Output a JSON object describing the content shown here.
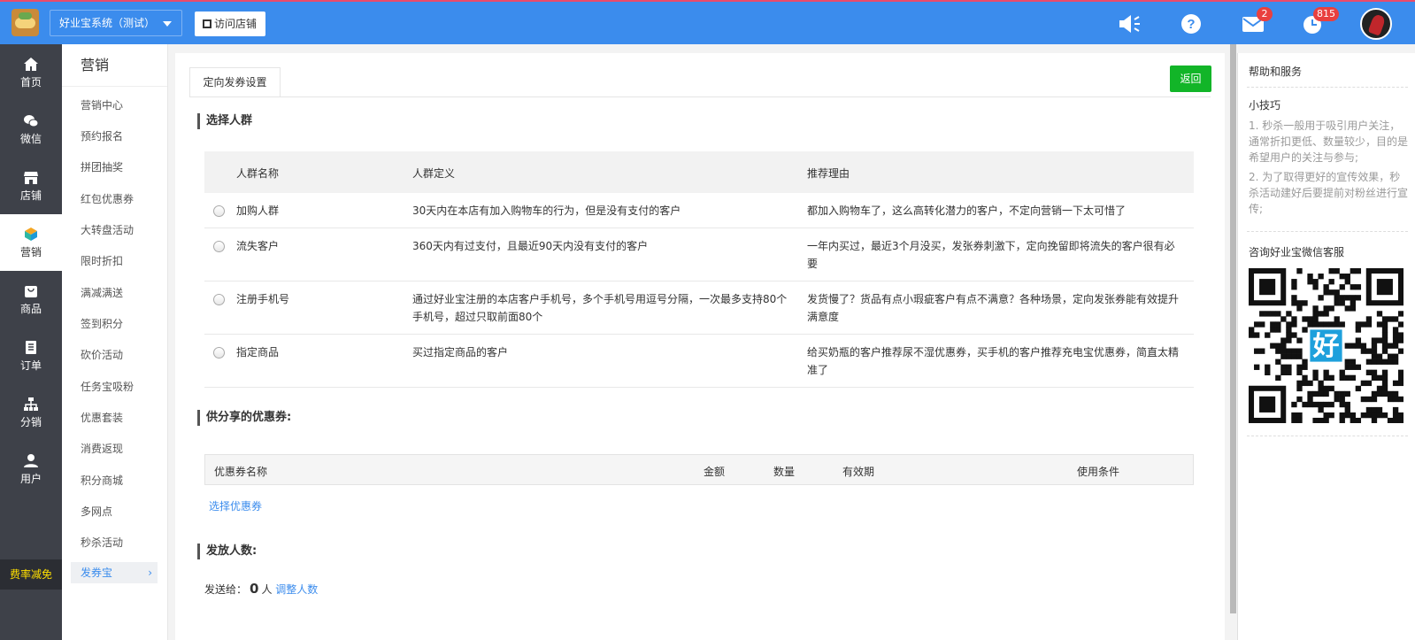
{
  "topbar": {
    "store_name": "好业宝系统（测试）",
    "visit_store_label": "访问店铺",
    "mail_badge": "2",
    "alarm_badge": "815"
  },
  "leftnav": {
    "items": [
      {
        "label": "首页",
        "icon": "home-icon"
      },
      {
        "label": "微信",
        "icon": "wechat-icon"
      },
      {
        "label": "店铺",
        "icon": "store-icon"
      },
      {
        "label": "营销",
        "icon": "marketing-cube-icon"
      },
      {
        "label": "商品",
        "icon": "goods-bag-icon"
      },
      {
        "label": "订单",
        "icon": "order-list-icon"
      },
      {
        "label": "分销",
        "icon": "distribution-tree-icon"
      },
      {
        "label": "用户",
        "icon": "user-icon"
      }
    ],
    "active": "营销",
    "promo_label": "费率减免"
  },
  "subnav": {
    "title": "营销",
    "items": [
      "营销中心",
      "预约报名",
      "拼团抽奖",
      "红包优惠券",
      "大转盘活动",
      "限时折扣",
      "满减满送",
      "签到积分",
      "砍价活动",
      "任务宝吸粉",
      "优惠套装",
      "消费返现",
      "积分商城",
      "多网点",
      "秒杀活动",
      "发券宝"
    ],
    "active": "发券宝"
  },
  "main": {
    "tab_label": "定向发券设置",
    "back_label": "返回",
    "crowd_section_title": "选择人群",
    "crowd_headers": [
      "人群名称",
      "人群定义",
      "推荐理由"
    ],
    "crowd_rows": [
      {
        "name": "加购人群",
        "definition": "30天内在本店有加入购物车的行为，但是没有支付的客户",
        "reason": "都加入购物车了，这么高转化潜力的客户，不定向营销一下太可惜了"
      },
      {
        "name": "流失客户",
        "definition": "360天内有过支付，且最近90天内没有支付的客户",
        "reason": "一年内买过，最近3个月没买，发张券刺激下，定向挽留即将流失的客户很有必要"
      },
      {
        "name": "注册手机号",
        "definition": "通过好业宝注册的本店客户手机号，多个手机号用逗号分隔，一次最多支持80个手机号，超过只取前面80个",
        "reason": "发货慢了？货品有点小瑕疵客户有点不满意？各种场景，定向发张券能有效提升满意度"
      },
      {
        "name": "指定商品",
        "definition": "买过指定商品的客户",
        "reason": "给买奶瓶的客户推荐尿不湿优惠券，买手机的客户推荐充电宝优惠券，简直太精准了"
      }
    ],
    "coupon_section_title": "供分享的优惠券:",
    "coupon_headers": [
      "优惠券名称",
      "金额",
      "数量",
      "有效期",
      "使用条件"
    ],
    "select_coupon_label": "选择优惠券",
    "send_section_title": "发放人数:",
    "send_prefix": "发送给：",
    "send_count": "0",
    "send_unit": "人",
    "adjust_label": "调整人数"
  },
  "help": {
    "title": "帮助和服务",
    "tips_title": "小技巧",
    "tips": [
      "1. 秒杀一般用于吸引用户关注，通常折扣更低、数量较少，目的是希望用户的关注与参与;",
      "2. 为了取得更好的宣传效果，秒杀活动建好后要提前对粉丝进行宣传;"
    ],
    "qr_title": "咨询好业宝微信客服",
    "qr_center_char": "好"
  },
  "colors": {
    "topbar": "#3b8ced",
    "leftnav": "#3e4149",
    "back_button": "#12b528",
    "promo_text": "#ffe000",
    "badge": "#e9403f"
  }
}
